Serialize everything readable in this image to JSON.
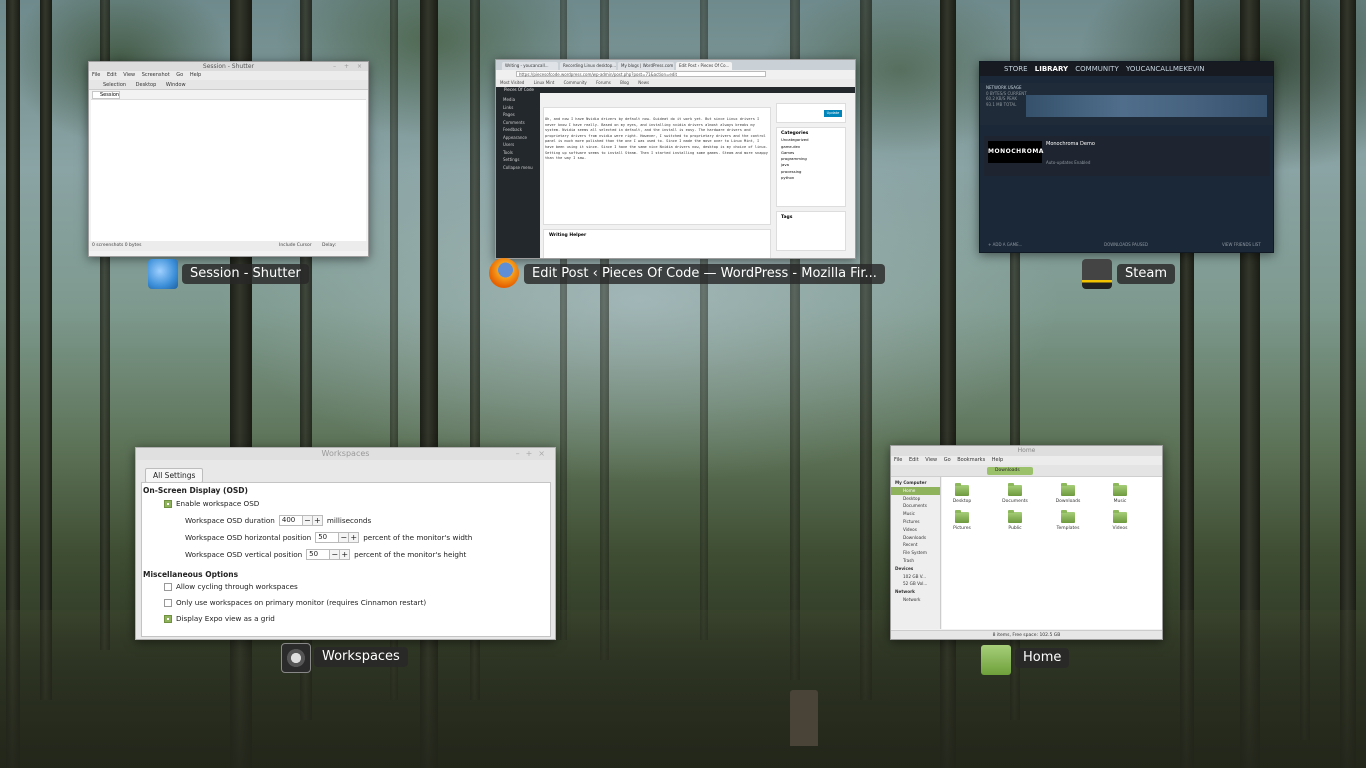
{
  "windows": {
    "shutter": {
      "caption": "Session - Shutter",
      "title": "Session - Shutter",
      "menu": [
        "File",
        "Edit",
        "View",
        "Screenshot",
        "Go",
        "Help"
      ],
      "toolbar": [
        "Selection",
        "Desktop",
        "Window"
      ],
      "tab": "Session",
      "status_left": "0 screenshots 0 bytes",
      "status_include_cursor": "Include Cursor",
      "status_delay": "Delay:"
    },
    "firefox": {
      "caption": "Edit Post ‹ Pieces Of Code — WordPress - Mozilla Fir...",
      "tabs": [
        "Writing - youcancall...",
        "Recording Linux desktop...",
        "My blogs | WordPress.com",
        "Edit Post ‹ Pieces Of Co..."
      ],
      "url": "https://piecesofcode.wordpress.com/wp-admin/post.php?post=71&action=edit",
      "bookmarks": [
        "Most Visited",
        "Linux Mint",
        "Community",
        "Forums",
        "Blog",
        "News"
      ],
      "admin_bar": "Pieces Of Code",
      "sidebar": [
        "Media",
        "Links",
        "Pages",
        "Comments",
        "Feedback",
        "Appearance",
        "Users",
        "Tools",
        "Settings",
        "Collapse menu"
      ],
      "body_text": "Oh, and now I have Nvidia drivers by default now. Guideat do it work yet. But since Linux drivers I never know I have really. Based on my eyes, and installing nvidia drivers almost always breaks my system. Nvidia seems all selected in default, and the install is easy. The hardware drivers and proprietary drivers from nvidia were right. However, I switched to proprietary drivers and the control panel is much more polished than the one I was used to. Since I made the move over to Linux Mint, I have been using it since. Since I have the same nice Nvidia drivers now, desktop is my choice of linux. Setting up software seems to install Steam. Then I started installing some games. Steam and more snappy than the way I saw.",
      "categories_title": "Categories",
      "categories": [
        "Uncategorized",
        "game-dev",
        "Games",
        "programming",
        "java",
        "processing",
        "python"
      ],
      "writing_helper": "Writing Helper",
      "tags_title": "Tags",
      "publish_button": "Update"
    },
    "steam": {
      "caption": "Steam",
      "nav": [
        "STORE",
        "LIBRARY",
        "COMMUNITY",
        "YOUCANCALLMEKEVIN"
      ],
      "downloads_label": "DOWNLOADS",
      "network_usage": "NETWORK USAGE",
      "current": "0 BYTES/S CURRENT",
      "peak": "60.2 KB/S PEAK",
      "total": "93.1 MB TOTAL",
      "game_logo": "MONOCHROMA",
      "game_name": "Monochroma Demo",
      "game_status": "Auto-updates Enabled",
      "add_game": "+ ADD A GAME...",
      "downloads_paused": "DOWNLOADS PAUSED",
      "view_friends": "VIEW FRIENDS LIST"
    },
    "workspaces": {
      "caption": "Workspaces",
      "title": "Workspaces",
      "all_settings": "All Settings",
      "osd_section": "On-Screen Display (OSD)",
      "enable_osd": "Enable workspace OSD",
      "osd_duration_label": "Workspace OSD duration",
      "osd_duration_value": "400",
      "osd_duration_unit": "milliseconds",
      "osd_horizontal_label": "Workspace OSD horizontal position",
      "osd_horizontal_value": "50",
      "osd_horizontal_unit": "percent of the monitor's width",
      "osd_vertical_label": "Workspace OSD vertical position",
      "osd_vertical_value": "50",
      "osd_vertical_unit": "percent of the monitor's height",
      "misc_section": "Miscellaneous Options",
      "allow_cycling": "Allow cycling through workspaces",
      "primary_only": "Only use workspaces on primary monitor (requires Cinnamon restart)",
      "expo_grid": "Display Expo view as a grid",
      "checkbox_states": {
        "enable_osd": true,
        "allow_cycling": false,
        "primary_only": false,
        "expo_grid": true
      }
    },
    "home": {
      "caption": "Home",
      "title": "Home",
      "menu": [
        "File",
        "Edit",
        "View",
        "Go",
        "Bookmarks",
        "Help"
      ],
      "path_button": "Downloads",
      "sidebar": {
        "my_computer": "My Computer",
        "places": [
          "Home",
          "Desktop",
          "Documents",
          "Music",
          "Pictures",
          "Videos",
          "Downloads",
          "Recent",
          "File System",
          "Trash"
        ],
        "devices": "Devices",
        "device_items": [
          "102 GB V...",
          "52 GB Vol..."
        ],
        "network": "Network",
        "network_items": [
          "Network"
        ]
      },
      "folders": [
        "Desktop",
        "Documents",
        "Downloads",
        "Music",
        "Pictures",
        "Public",
        "Templates",
        "Videos"
      ],
      "status": "8 items, Free space: 102.5 GB"
    }
  },
  "colors": {
    "shutter_icon": "#3c8fd8",
    "firefox_icon": "#e66000",
    "steam_icon": "#1b2838",
    "workspaces_icon": "#2b2b2b",
    "home_icon": "#6ea03a",
    "mint_green": "#8fb35c"
  },
  "icons": {
    "shutter": "shutter-app-icon",
    "firefox": "firefox-app-icon",
    "steam": "steam-app-icon",
    "workspaces": "workspaces-app-icon",
    "home": "folder-app-icon"
  }
}
